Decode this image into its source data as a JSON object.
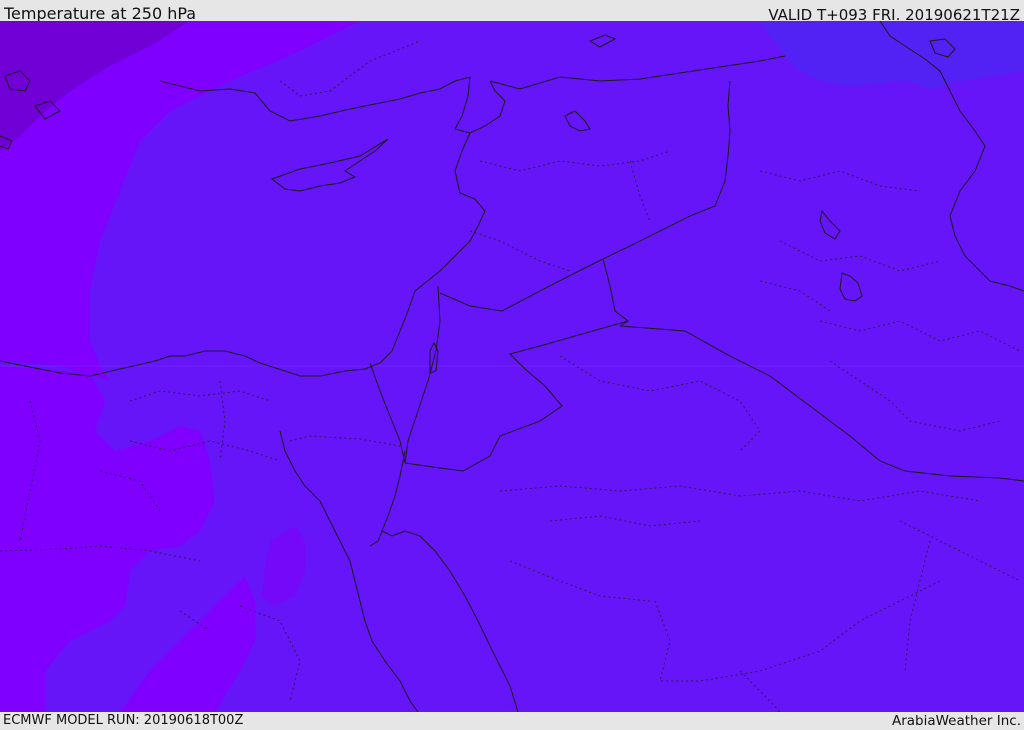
{
  "header": {
    "title": "Temperature at 250 hPa",
    "valid_time": "VALID T+093 FRI. 20190621T21Z"
  },
  "footer": {
    "model_run": "ECMWF MODEL RUN: 20190618T00Z",
    "credit": "ArabiaWeather Inc."
  },
  "map": {
    "fill_colors": {
      "base": "#6615f9",
      "warm_band": "#7f00fe",
      "cold_patch": "#5222f5",
      "dark_corner": "#7000d6",
      "mid_band": "#7608fa"
    },
    "border_color": "#1a1a1a"
  }
}
